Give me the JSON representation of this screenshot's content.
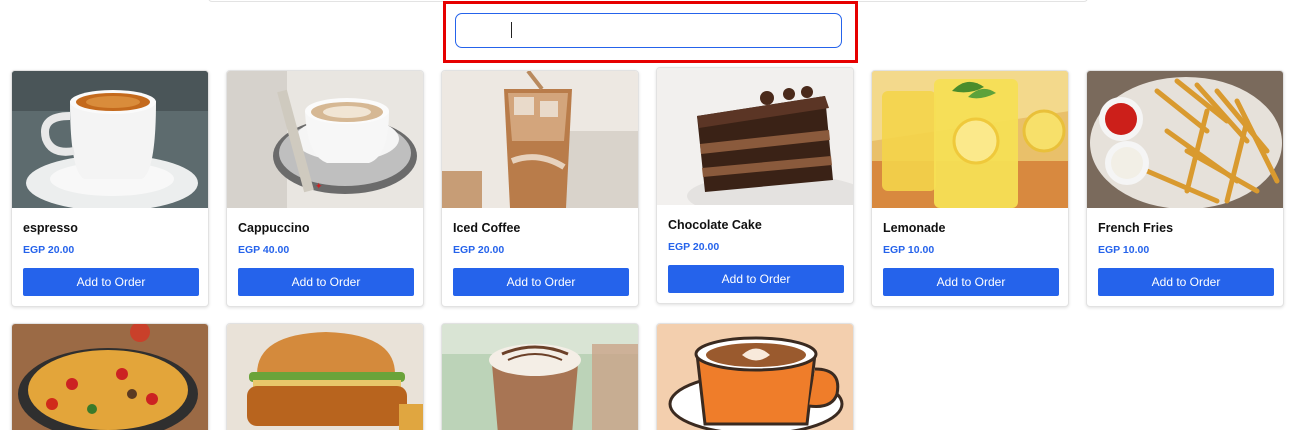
{
  "search": {
    "value": "",
    "placeholder": ""
  },
  "products": [
    {
      "name": "espresso",
      "price": "EGP 20.00",
      "button": "Add to Order",
      "image": "espresso-cup"
    },
    {
      "name": "Cappuccino",
      "price": "EGP 40.00",
      "button": "Add to Order",
      "image": "cappuccino-cup"
    },
    {
      "name": "Iced Coffee",
      "price": "EGP 20.00",
      "button": "Add to Order",
      "image": "iced-coffee-glass"
    },
    {
      "name": "Chocolate Cake",
      "price": "EGP 20.00",
      "button": "Add to Order",
      "image": "chocolate-cake-slice"
    },
    {
      "name": "Lemonade",
      "price": "EGP 10.00",
      "button": "Add to Order",
      "image": "lemonade-glasses"
    },
    {
      "name": "French Fries",
      "price": "EGP 10.00",
      "button": "Add to Order",
      "image": "french-fries-plate"
    }
  ],
  "products_row2": [
    {
      "image": "nachos-plate"
    },
    {
      "image": "chicken-burger"
    },
    {
      "image": "hot-chocolate-mug"
    },
    {
      "image": "latte-art-cup-illustration"
    }
  ],
  "colors": {
    "accent": "#2563eb",
    "highlight": "#e60000"
  }
}
